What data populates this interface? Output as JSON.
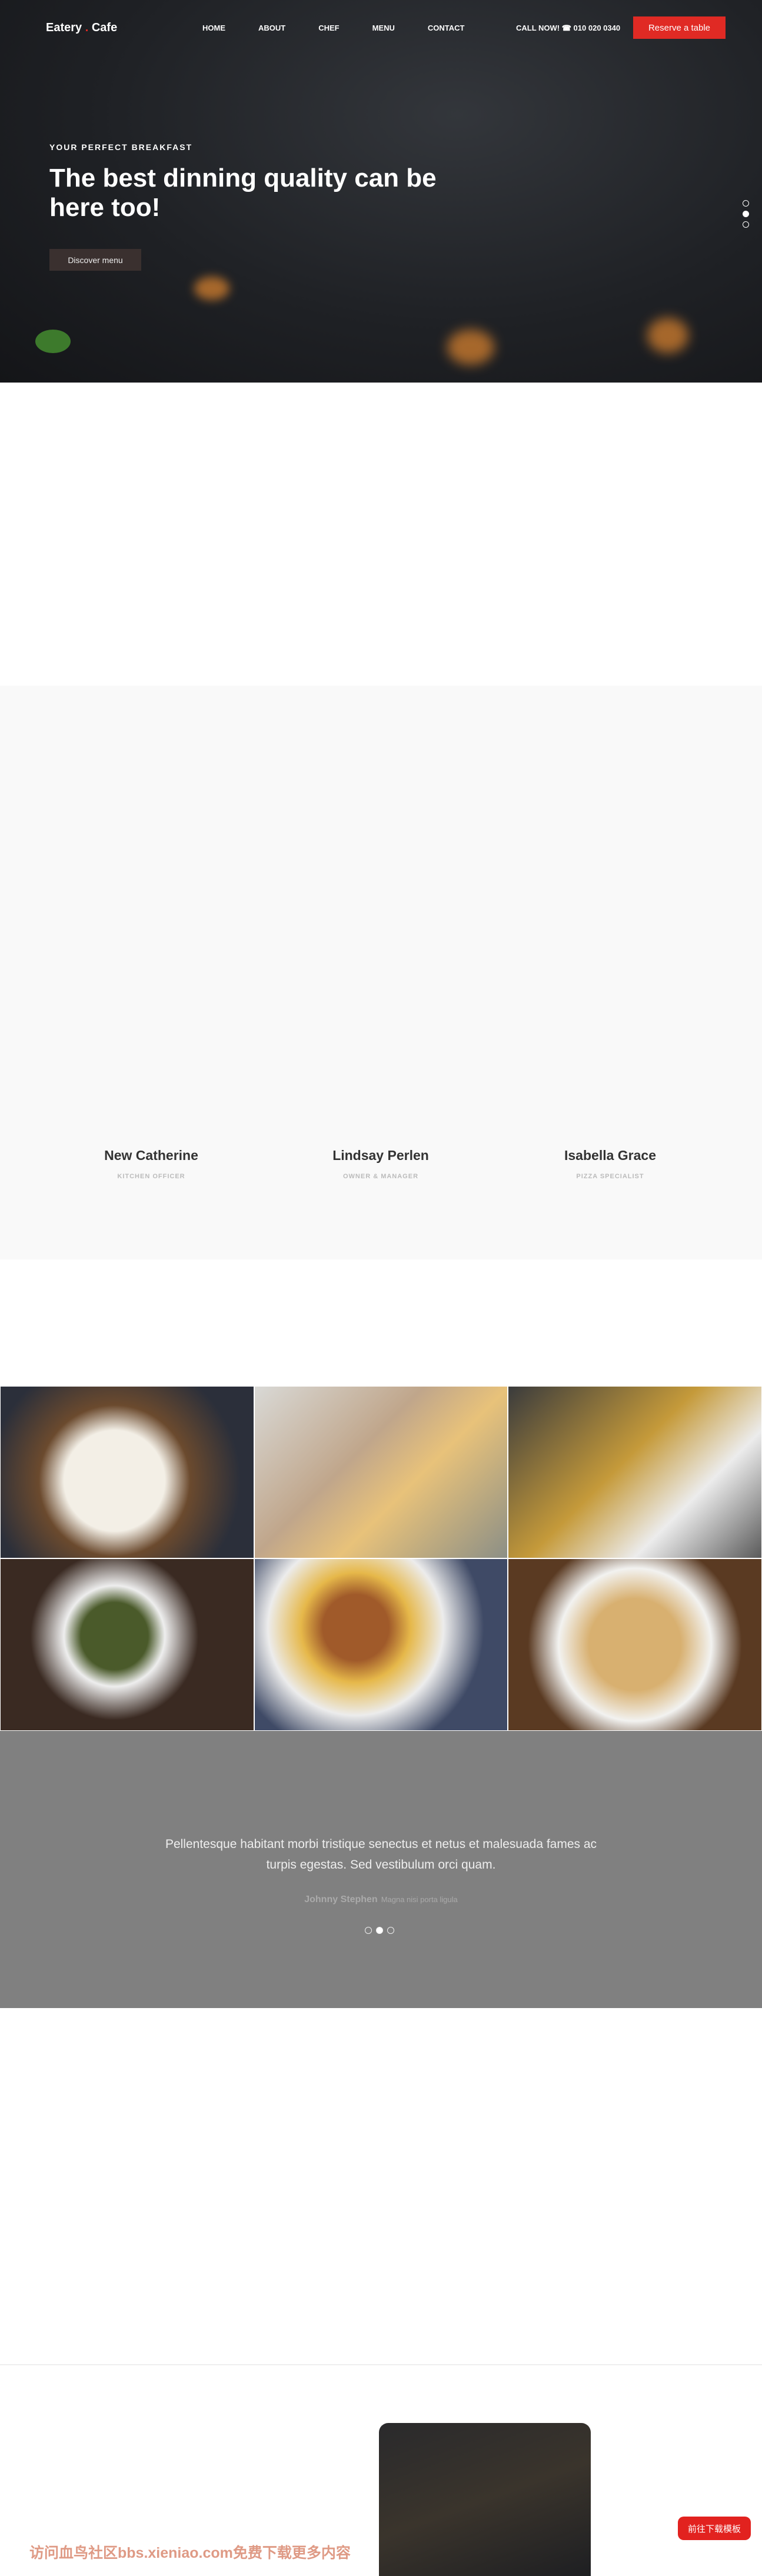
{
  "header": {
    "logo_left": "Eatery",
    "logo_dot": ".",
    "logo_right": "Cafe",
    "nav": [
      "HOME",
      "ABOUT",
      "CHEF",
      "MENU",
      "CONTACT"
    ],
    "call": "CALL NOW! ☎ 010 020 0340",
    "reserve": "Reserve a table"
  },
  "hero": {
    "kicker": "YOUR PERFECT BREAKFAST",
    "headline": "The best dinning quality can be here too!",
    "button": "Discover menu",
    "slide_active": 2,
    "slide_count": 3
  },
  "team": [
    {
      "name": "New Catherine",
      "role": "KITCHEN OFFICER"
    },
    {
      "name": "Lindsay Perlen",
      "role": "OWNER & MANAGER"
    },
    {
      "name": "Isabella Grace",
      "role": "PIZZA SPECIALIST"
    }
  ],
  "testimonial": {
    "quote": "Pellentesque habitant morbi tristique senectus et netus et malesuada fames ac turpis egestas. Sed vestibulum orci quam.",
    "author": "Johnny Stephen",
    "subtitle": "Magna nisi porta ligula",
    "slide_active": 2
  },
  "footer": {
    "watermark": "访问血鸟社区bbs.xieniao.com免费下载更多内容",
    "download": "前往下载模板"
  },
  "colors": {
    "accent": "#e02a24",
    "testimonial_bg": "#808080",
    "team_bg": "#f9f9f9"
  }
}
